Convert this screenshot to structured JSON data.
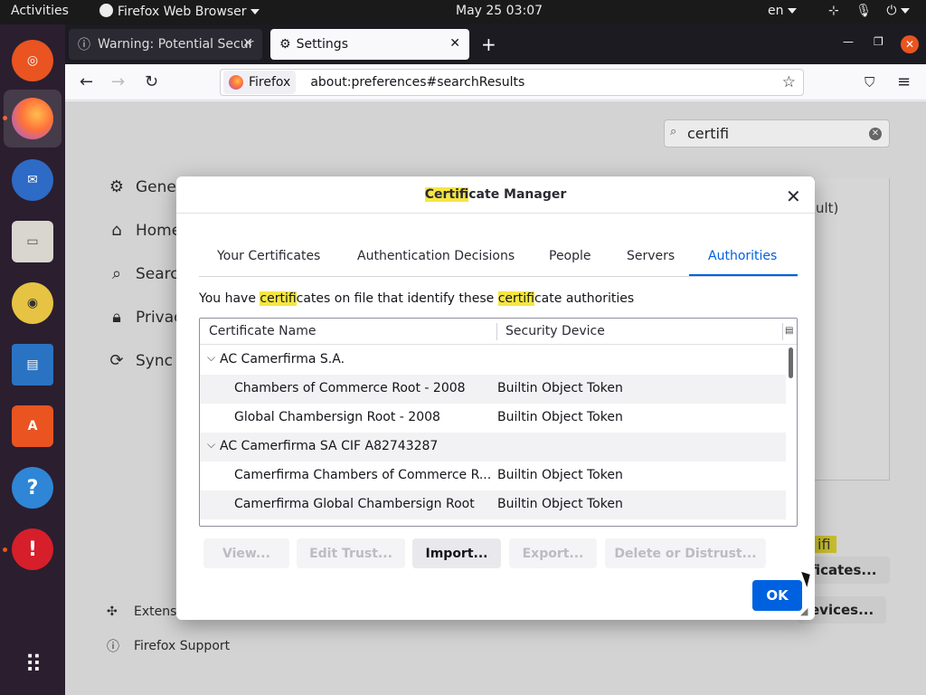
{
  "topbar": {
    "activities": "Activities",
    "app_name": "Firefox Web Browser",
    "clock": "May 25  03:07",
    "lang": "en"
  },
  "browser": {
    "tabs": [
      {
        "title": "Warning: Potential Secur",
        "icon": "warning-icon"
      },
      {
        "title": "Settings",
        "icon": "gear-icon"
      }
    ],
    "identity_label": "Firefox",
    "url": "about:preferences#searchResults"
  },
  "settings": {
    "search_value": "certifi",
    "sidebar": [
      {
        "label": "Gener",
        "icon": "gear-icon"
      },
      {
        "label": "Home",
        "icon": "home-icon"
      },
      {
        "label": "Search",
        "icon": "search-icon"
      },
      {
        "label": "Privac",
        "icon": "lock-icon"
      },
      {
        "label": "Sync",
        "icon": "sync-icon"
      }
    ],
    "extensions_label": "Extens",
    "support_label": "Firefox Support",
    "bg_text_1": "ult)",
    "bg_highlight": "ifi",
    "bg_button_certificates": "ficates...",
    "bg_button_devices": "evices..."
  },
  "dialog": {
    "title_highlight": "Certifi",
    "title_rest": "cate Manager",
    "tabs": [
      "Your Certificates",
      "Authentication Decisions",
      "People",
      "Servers",
      "Authorities"
    ],
    "selected_tab": "Authorities",
    "desc_1": "You have ",
    "desc_hl_1": "certifi",
    "desc_2": "cates on file that identify these ",
    "desc_hl_2": "certifi",
    "desc_3": "cate authorities",
    "columns": [
      "Certificate Name",
      "Security Device"
    ],
    "rows": [
      {
        "name": "AC Camerfirma S.A.",
        "device": "",
        "group": true
      },
      {
        "name": "Chambers of Commerce Root - 2008",
        "device": "Builtin Object Token",
        "group": false
      },
      {
        "name": "Global Chambersign Root - 2008",
        "device": "Builtin Object Token",
        "group": false
      },
      {
        "name": "AC Camerfirma SA CIF A82743287",
        "device": "",
        "group": true
      },
      {
        "name": "Camerfirma Chambers of Commerce R...",
        "device": "Builtin Object Token",
        "group": false
      },
      {
        "name": "Camerfirma Global Chambersign Root",
        "device": "Builtin Object Token",
        "group": false
      }
    ],
    "buttons": {
      "view": "View...",
      "edit_trust": "Edit Trust...",
      "import": "Import...",
      "export": "Export...",
      "delete": "Delete or Distrust..."
    },
    "ok": "OK"
  },
  "colors": {
    "accent": "#0061e0",
    "highlight": "#f5e642",
    "ubuntu_orange": "#e95420"
  }
}
